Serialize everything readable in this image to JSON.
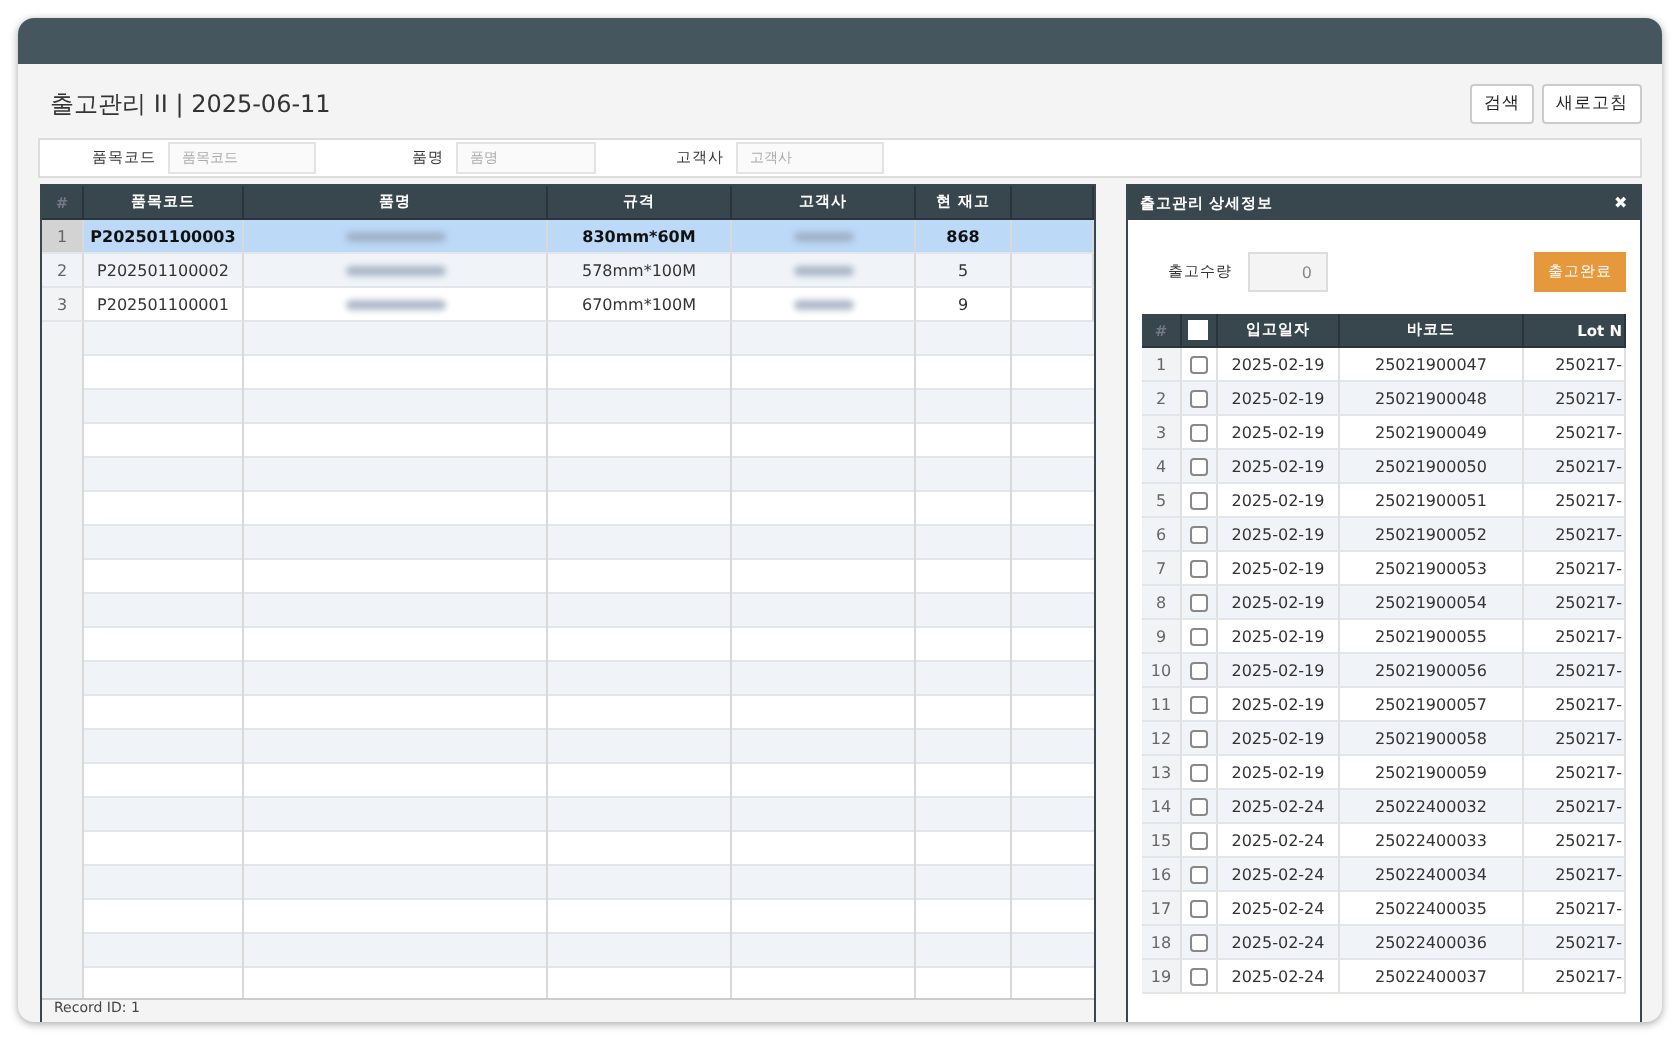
{
  "page": {
    "title": "출고관리 II | 2025-06-11"
  },
  "buttons": [
    "검색",
    "새로고침"
  ],
  "filters": [
    {
      "label": "품목코드",
      "placeholder": "품목코드"
    },
    {
      "label": "품명",
      "placeholder": "품명"
    },
    {
      "label": "고객사",
      "placeholder": "고객사"
    }
  ],
  "table": {
    "columns": [
      "#",
      "품목코드",
      "품명",
      "규격",
      "고객사",
      "현 재고"
    ],
    "rows": [
      {
        "no": "1",
        "code": "P202501100003",
        "spec": "830mm*60M",
        "stock": "868",
        "selected": true
      },
      {
        "no": "2",
        "code": "P202501100002",
        "spec": "578mm*100M",
        "stock": "5",
        "selected": false
      },
      {
        "no": "3",
        "code": "P202501100001",
        "spec": "670mm*100M",
        "stock": "9",
        "selected": false
      }
    ]
  },
  "status_bar": "Record ID: 1",
  "detail": {
    "title": "출고관리 상세정보",
    "close": "✖",
    "qty_label": "출고수량",
    "qty_value": "0",
    "confirm": "출고완료",
    "columns": [
      "#",
      "입고일자",
      "바코드",
      "Lot N"
    ],
    "all_checked": false,
    "rows": [
      {
        "no": "1",
        "date": "2025-02-19",
        "barcode": "25021900047",
        "lot": "250217-",
        "checked": false
      },
      {
        "no": "2",
        "date": "2025-02-19",
        "barcode": "25021900048",
        "lot": "250217-",
        "checked": false
      },
      {
        "no": "3",
        "date": "2025-02-19",
        "barcode": "25021900049",
        "lot": "250217-",
        "checked": false
      },
      {
        "no": "4",
        "date": "2025-02-19",
        "barcode": "25021900050",
        "lot": "250217-",
        "checked": false
      },
      {
        "no": "5",
        "date": "2025-02-19",
        "barcode": "25021900051",
        "lot": "250217-",
        "checked": false
      },
      {
        "no": "6",
        "date": "2025-02-19",
        "barcode": "25021900052",
        "lot": "250217-",
        "checked": false
      },
      {
        "no": "7",
        "date": "2025-02-19",
        "barcode": "25021900053",
        "lot": "250217-",
        "checked": false
      },
      {
        "no": "8",
        "date": "2025-02-19",
        "barcode": "25021900054",
        "lot": "250217-",
        "checked": false
      },
      {
        "no": "9",
        "date": "2025-02-19",
        "barcode": "25021900055",
        "lot": "250217-",
        "checked": false
      },
      {
        "no": "10",
        "date": "2025-02-19",
        "barcode": "25021900056",
        "lot": "250217-",
        "checked": false
      },
      {
        "no": "11",
        "date": "2025-02-19",
        "barcode": "25021900057",
        "lot": "250217-",
        "checked": false
      },
      {
        "no": "12",
        "date": "2025-02-19",
        "barcode": "25021900058",
        "lot": "250217-",
        "checked": false
      },
      {
        "no": "13",
        "date": "2025-02-19",
        "barcode": "25021900059",
        "lot": "250217-",
        "checked": false
      },
      {
        "no": "14",
        "date": "2025-02-24",
        "barcode": "25022400032",
        "lot": "250217-",
        "checked": false
      },
      {
        "no": "15",
        "date": "2025-02-24",
        "barcode": "25022400033",
        "lot": "250217-",
        "checked": false
      },
      {
        "no": "16",
        "date": "2025-02-24",
        "barcode": "25022400034",
        "lot": "250217-",
        "checked": false
      },
      {
        "no": "17",
        "date": "2025-02-24",
        "barcode": "25022400035",
        "lot": "250217-",
        "checked": false
      },
      {
        "no": "18",
        "date": "2025-02-24",
        "barcode": "25022400036",
        "lot": "250217-",
        "checked": false
      },
      {
        "no": "19",
        "date": "2025-02-24",
        "barcode": "25022400037",
        "lot": "250217-",
        "checked": false
      }
    ]
  }
}
